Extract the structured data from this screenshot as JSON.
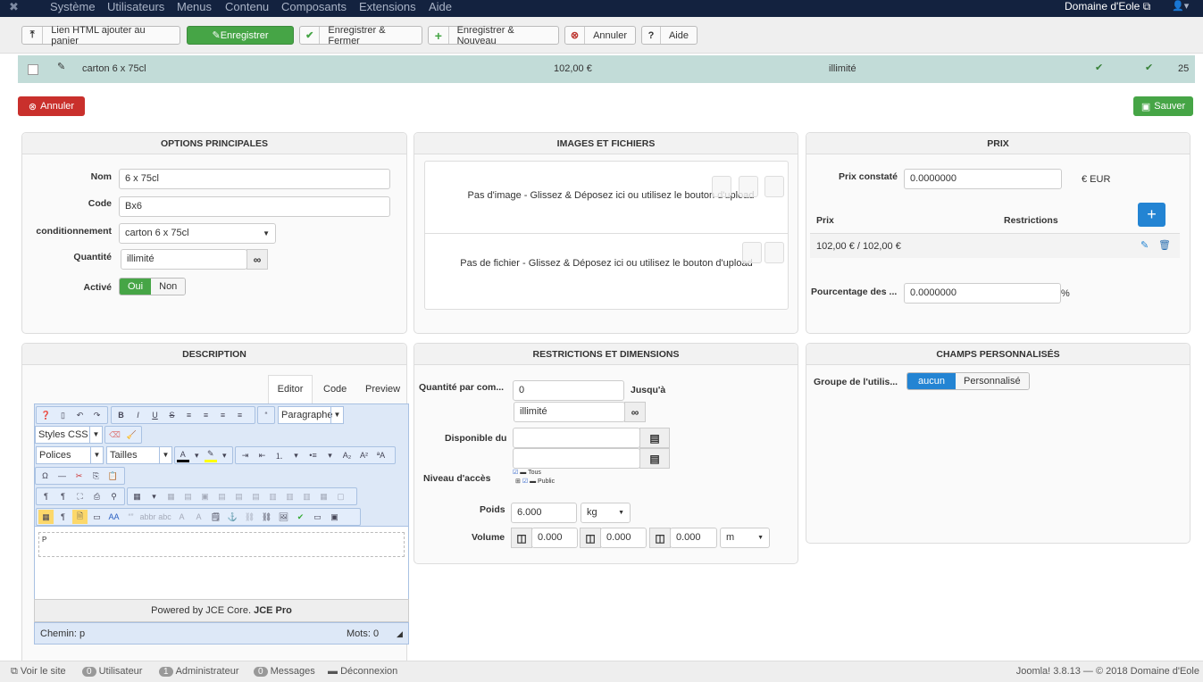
{
  "nav": {
    "menus": [
      "Système",
      "Utilisateurs",
      "Menus",
      "Contenu",
      "Composants",
      "Extensions",
      "Aide"
    ],
    "site": "Domaine d'Eole"
  },
  "toolbar": {
    "html_link": "Lien HTML ajouter au panier",
    "save": "Enregistrer",
    "save_close": "Enregistrer & Fermer",
    "save_new": "Enregistrer & Nouveau",
    "cancel": "Annuler",
    "help": "Aide"
  },
  "row": {
    "name": "carton 6 x 75cl",
    "price": "102,00 €",
    "stock": "illimité",
    "id": "25"
  },
  "actions": {
    "cancel": "Annuler",
    "save": "Sauver"
  },
  "options": {
    "title": "OPTIONS PRINCIPALES",
    "nom_label": "Nom",
    "nom": "6 x 75cl",
    "code_label": "Code",
    "code": "Bx6",
    "cond_label": "conditionnement",
    "cond": "carton 6 x 75cl",
    "qty_label": "Quantité",
    "qty": "illimité",
    "active_label": "Activé",
    "yes": "Oui",
    "no": "Non"
  },
  "images": {
    "title": "IMAGES ET FICHIERS",
    "no_image": "Pas d'image - Glissez & Déposez ici ou utilisez le bouton d'upload",
    "no_file": "Pas de fichier - Glissez & Déposez ici ou utilisez le bouton d'upload"
  },
  "prix": {
    "title": "PRIX",
    "constate_label": "Prix constaté",
    "constate": "0.0000000",
    "currency": "€ EUR",
    "col_prix": "Prix",
    "col_restr": "Restrictions",
    "row_price": "102,00 € / 102,00 €",
    "pct_label": "Pourcentage des ...",
    "pct": "0.0000000",
    "pct_unit": "%"
  },
  "desc": {
    "title": "DESCRIPTION",
    "tabs": [
      "Editor",
      "Code",
      "Preview"
    ],
    "format": "Paragraphe",
    "styles": "Styles CSS",
    "fonts": "Polices",
    "sizes": "Tailles",
    "content": "P",
    "powered": "Powered by JCE Core.",
    "pro": "JCE Pro",
    "path": "Chemin: p",
    "words": "Mots: 0"
  },
  "restr": {
    "title": "RESTRICTIONS ET DIMENSIONS",
    "qty_label": "Quantité par com...",
    "qty_min": "0",
    "until": "Jusqu'à",
    "qty_max": "illimité",
    "avail_label": "Disponible du",
    "access_label": "Niveau d'accès",
    "access": [
      "Tous",
      "Public"
    ],
    "weight_label": "Poids",
    "weight": "6.000",
    "weight_unit": "kg",
    "volume_label": "Volume",
    "vol": [
      "0.000",
      "0.000",
      "0.000"
    ],
    "vol_unit": "m"
  },
  "custom": {
    "title": "CHAMPS PERSONNALISÉS",
    "group_label": "Groupe de l'utilis...",
    "none": "aucun",
    "custom": "Personnalisé"
  },
  "footer": {
    "view_site": "Voir le site",
    "users_count": "0",
    "users": "Utilisateur",
    "admins_count": "1",
    "admins": "Administrateur",
    "msg_count": "0",
    "messages": "Messages",
    "logout": "Déconnexion",
    "version": "Joomla! 3.8.13  —  © 2018 Domaine d'Eole"
  }
}
